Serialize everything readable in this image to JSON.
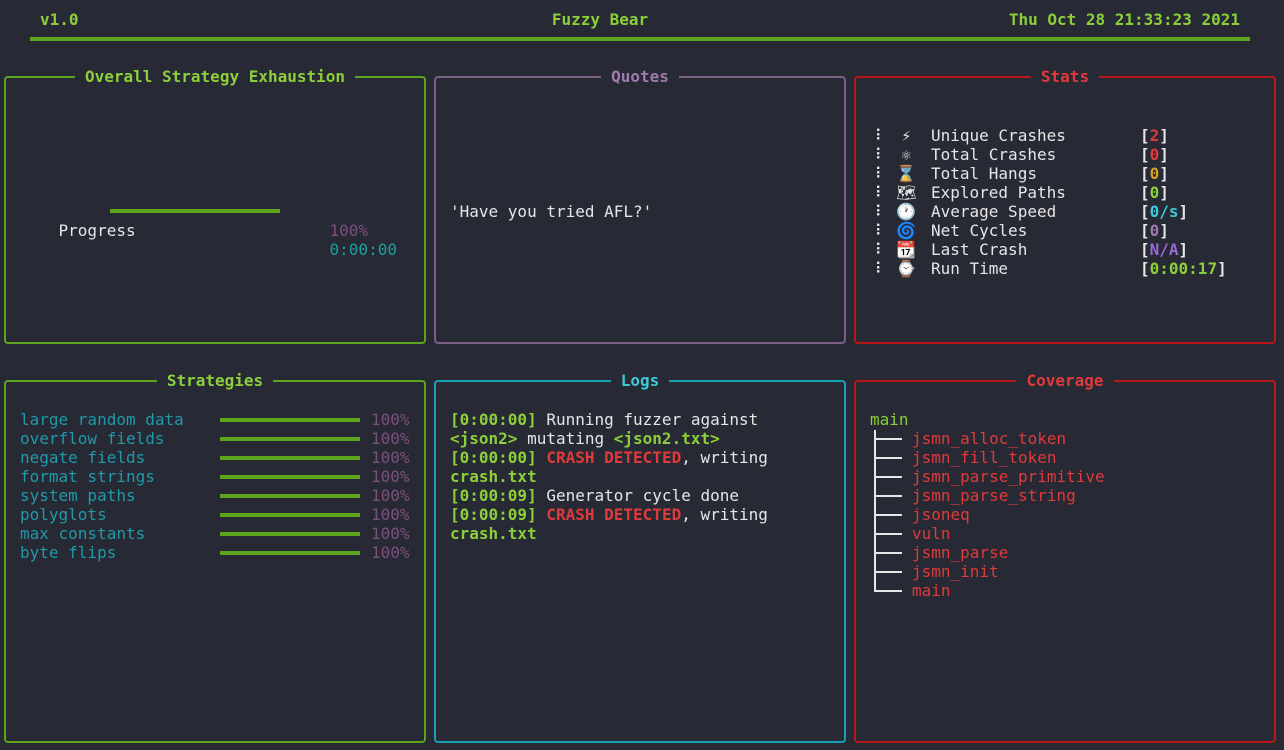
{
  "header": {
    "version": "v1.0",
    "title": "Fuzzy Bear",
    "datetime": "Thu Oct 28 21:33:23 2021"
  },
  "exhaustion": {
    "title": "Overall Strategy Exhaustion",
    "progress_label": "Progress",
    "progress_percent": "100%",
    "progress_value": 1.0,
    "eta": "0:00:00"
  },
  "quotes": {
    "title": "Quotes",
    "text": "'Have you tried AFL?'"
  },
  "stats": {
    "title": "Stats",
    "items": [
      {
        "icon": "lightning-icon",
        "glyph": "⚡",
        "label": "Unique Crashes",
        "value": "2",
        "color": "#e03a3a"
      },
      {
        "icon": "atom-icon",
        "glyph": "⚛",
        "label": "Total Crashes",
        "value": "0",
        "color": "#e03a3a"
      },
      {
        "icon": "hourglass-icon",
        "glyph": "⌛",
        "label": "Total Hangs",
        "value": "0",
        "color": "#d0a020"
      },
      {
        "icon": "map-icon",
        "glyph": "🗺",
        "label": "Explored Paths",
        "value": "0",
        "color": "#8ccf3a"
      },
      {
        "icon": "clock-icon",
        "glyph": "🕐",
        "label": "Average Speed",
        "value": "0/s",
        "color": "#3fc8d9"
      },
      {
        "icon": "cyclone-icon",
        "glyph": "🌀",
        "label": "Net Cycles",
        "value": "0",
        "color": "#9a7ab0"
      },
      {
        "icon": "calendar-icon",
        "glyph": "📆",
        "label": "Last Crash",
        "value": "N/A",
        "color": "#9a6ad8"
      },
      {
        "icon": "watch-icon",
        "glyph": "⌚",
        "label": "Run Time",
        "value": "0:00:17",
        "color": "#8ccf3a"
      }
    ]
  },
  "strategies": {
    "title": "Strategies",
    "items": [
      {
        "name": "large random data",
        "percent": "100%",
        "progress": 1.0
      },
      {
        "name": "overflow fields",
        "percent": "100%",
        "progress": 1.0
      },
      {
        "name": "negate fields",
        "percent": "100%",
        "progress": 1.0
      },
      {
        "name": "format strings",
        "percent": "100%",
        "progress": 1.0
      },
      {
        "name": "system paths",
        "percent": "100%",
        "progress": 1.0
      },
      {
        "name": "polyglots",
        "percent": "100%",
        "progress": 1.0
      },
      {
        "name": "max constants",
        "percent": "100%",
        "progress": 1.0
      },
      {
        "name": "byte flips",
        "percent": "100%",
        "progress": 1.0
      }
    ]
  },
  "logs": {
    "title": "Logs",
    "lines": [
      [
        {
          "t": "[0:00:00]",
          "c": "g"
        },
        {
          "t": " Running fuzzer against",
          "c": ""
        }
      ],
      [
        {
          "t": "<json2>",
          "c": "g"
        },
        {
          "t": " mutating ",
          "c": ""
        },
        {
          "t": "<json2.txt>",
          "c": "g"
        }
      ],
      [
        {
          "t": "[0:00:00]",
          "c": "g"
        },
        {
          "t": " ",
          "c": ""
        },
        {
          "t": "CRASH DETECTED",
          "c": "r"
        },
        {
          "t": ", writing",
          "c": ""
        }
      ],
      [
        {
          "t": "crash.txt",
          "c": "g"
        }
      ],
      [
        {
          "t": "[0:00:09]",
          "c": "g"
        },
        {
          "t": " Generator cycle done",
          "c": ""
        }
      ],
      [
        {
          "t": "[0:00:09]",
          "c": "g"
        },
        {
          "t": " ",
          "c": ""
        },
        {
          "t": "CRASH DETECTED",
          "c": "r"
        },
        {
          "t": ", writing",
          "c": ""
        }
      ],
      [
        {
          "t": "crash.txt",
          "c": "g"
        }
      ]
    ]
  },
  "coverage": {
    "title": "Coverage",
    "root": "main",
    "children": [
      "jsmn_alloc_token",
      "jsmn_fill_token",
      "jsmn_parse_primitive",
      "jsmn_parse_string",
      "jsoneq",
      "vuln",
      "jsmn_parse",
      "jsmn_init",
      "main"
    ]
  }
}
